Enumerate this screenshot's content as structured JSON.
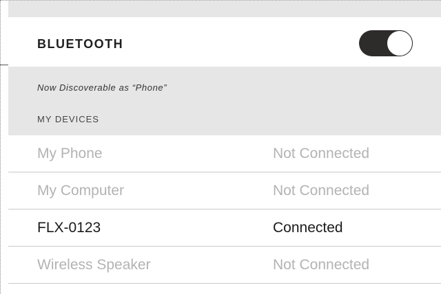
{
  "header": {
    "title": "BLUETOOTH",
    "toggle_on": true
  },
  "info": {
    "discoverable_text": "Now Discoverable as “Phone”",
    "section_label": "MY DEVICES"
  },
  "devices": [
    {
      "name": "My Phone",
      "status": "Not Connected",
      "connected": false
    },
    {
      "name": "My Computer",
      "status": "Not Connected",
      "connected": false
    },
    {
      "name": "FLX-0123",
      "status": "Connected",
      "connected": true
    },
    {
      "name": "Wireless Speaker",
      "status": "Not Connected",
      "connected": false
    }
  ],
  "colors": {
    "toggle_track": "#2e2b2b",
    "section_background": "#e6e6e6",
    "inactive_text": "#b3b3b3",
    "active_text": "#1a1a1a"
  }
}
